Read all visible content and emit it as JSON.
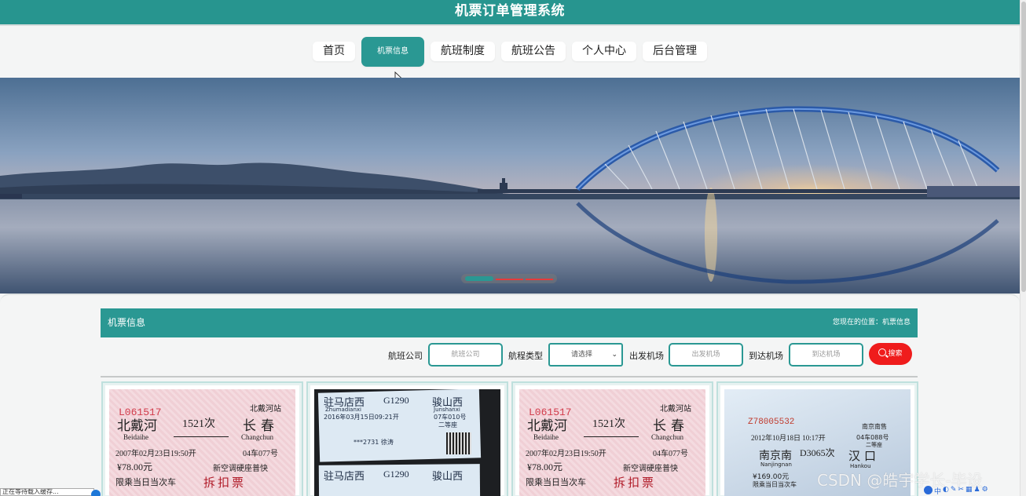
{
  "header": {
    "title": "机票订单管理系统"
  },
  "nav": {
    "items": [
      {
        "label": "首页"
      },
      {
        "label": "机票信息"
      },
      {
        "label": "航班制度"
      },
      {
        "label": "航班公告"
      },
      {
        "label": "个人中心"
      },
      {
        "label": "后台管理"
      }
    ]
  },
  "banner": {
    "active_slide": 1,
    "slide_count": 3
  },
  "panel": {
    "title": "机票信息",
    "location_prefix": "您现在的位置：",
    "location": "机票信息"
  },
  "search": {
    "airline_label": "航班公司",
    "airline_placeholder": "航班公司",
    "type_label": "航程类型",
    "type_selected": "请选择",
    "from_label": "出发机场",
    "from_placeholder": "出发机场",
    "to_label": "到达机场",
    "to_placeholder": "到达机场",
    "button_label": "搜索"
  },
  "cards": [
    {
      "ticket_no": "L061517",
      "station_from": "北戴河",
      "station_to": "长春",
      "train": "1521次",
      "from_py": "Beidaihe",
      "to_py": "Changchun",
      "date": "2007年02月23日19:50开",
      "seat": "04车077号",
      "price": "¥78.00元",
      "class": "新空调硬座普快",
      "note": "限乘当日当次车",
      "stamp": "拆扣票",
      "top_right": "北戴河站"
    },
    {
      "ticket_no": "",
      "station_from": "驻马店西",
      "station_to": "骏山西",
      "train": "G1290",
      "from_py": "Zhumadianxi",
      "to_py": "Junshanxi",
      "date": "2016年03月15日09:21开",
      "seat": "07车010号",
      "price": "",
      "class": "二等座",
      "note": "",
      "stamp": "",
      "top_right": "***2731 徐涛"
    },
    {
      "ticket_no": "L061517",
      "station_from": "北戴河",
      "station_to": "长春",
      "train": "1521次",
      "from_py": "Beidaihe",
      "to_py": "Changchun",
      "date": "2007年02月23日19:50开",
      "seat": "04车077号",
      "price": "¥78.00元",
      "class": "新空调硬座普快",
      "note": "限乘当日当次车",
      "stamp": "拆扣票",
      "top_right": "北戴河站"
    },
    {
      "ticket_no": "Z78005532",
      "station_from": "南京南",
      "station_to": "汉口",
      "train": "D3065次",
      "from_py": "Nanjingnan",
      "to_py": "Hankou",
      "date": "2012年10月18日 10:17开",
      "seat": "04车088号",
      "price": "¥169.00元",
      "class": "二等座",
      "note": "限乘当日当次车",
      "stamp": "",
      "top_right": "南京南售"
    }
  ],
  "watermark": "CSDN @皓宇学长-毕设",
  "status_text": "正在等待载入缓存...",
  "colors": {
    "accent": "#2a9893",
    "search_button": "#ef1c1c",
    "header": "#27958f"
  }
}
